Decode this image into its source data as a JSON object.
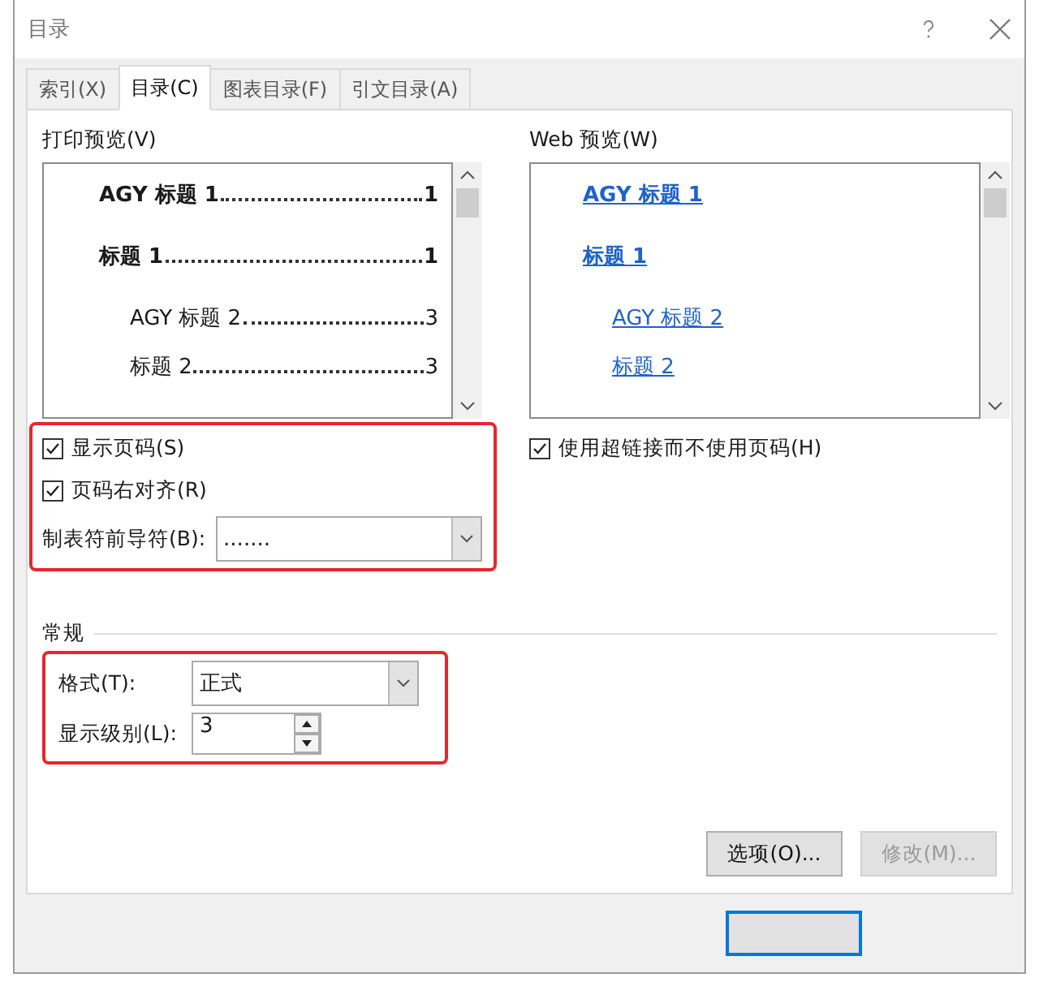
{
  "window": {
    "title": "目录"
  },
  "tabs": [
    {
      "label": "索引(X)",
      "selected": false
    },
    {
      "label": "目录(C)",
      "selected": true
    },
    {
      "label": "图表目录(F)",
      "selected": false
    },
    {
      "label": "引文目录(A)",
      "selected": false
    }
  ],
  "print_preview": {
    "label": "打印预览(V)",
    "entries": [
      {
        "kind": "level1",
        "text": "AGY 标题 1",
        "page": "1"
      },
      {
        "kind": "level1",
        "text": "标题  1",
        "page": "1"
      },
      {
        "kind": "level2",
        "text": "AGY 标题 2",
        "page": "3"
      },
      {
        "kind": "level2",
        "text": "标题  2",
        "page": "3"
      }
    ]
  },
  "web_preview": {
    "label": "Web 预览(W)",
    "entries": [
      {
        "kind": "level1",
        "text": "AGY 标题 1"
      },
      {
        "kind": "level1",
        "text": "标题  1"
      },
      {
        "kind": "level2",
        "text": "AGY 标题 2"
      },
      {
        "kind": "level2",
        "text": "标题  2"
      }
    ]
  },
  "print_options": [
    {
      "label": "显示页码(S)",
      "checked": true
    },
    {
      "label": "页码右对齐(R)",
      "checked": true
    }
  ],
  "tab_leader": {
    "label": "制表符前导符(B):",
    "value": "......."
  },
  "web_options": [
    {
      "label": "使用超链接而不使用页码(H)",
      "checked": true
    }
  ],
  "general": {
    "title": "常规",
    "format": {
      "label": "格式(T):",
      "value": "正式"
    },
    "levels": {
      "label": "显示级别(L):",
      "value": "3"
    }
  },
  "buttons": [
    {
      "label": "选项(O)...",
      "disabled": false
    },
    {
      "label": "修改(M)...",
      "disabled": true
    }
  ]
}
